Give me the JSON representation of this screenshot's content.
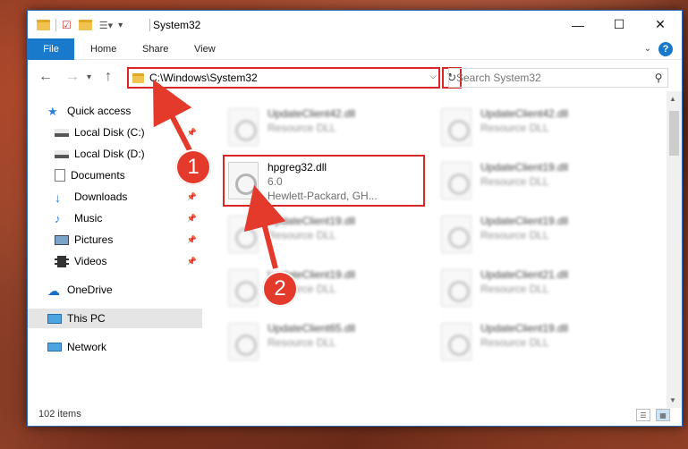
{
  "window": {
    "title": "System32",
    "controls": {
      "minimize": "—",
      "maximize": "☐",
      "close": "✕"
    }
  },
  "ribbon": {
    "tabs": [
      "File",
      "Home",
      "Share",
      "View"
    ],
    "help": "?"
  },
  "navigation": {
    "address": "C:\\Windows\\System32",
    "search_placeholder": "Search System32"
  },
  "sidebar": {
    "items": [
      {
        "label": "Quick access",
        "icon": "star-icon",
        "pinned": false
      },
      {
        "label": "Local Disk (C:)",
        "icon": "drive-icon",
        "pinned": true
      },
      {
        "label": "Local Disk (D:)",
        "icon": "drive-icon",
        "pinned": false
      },
      {
        "label": "Documents",
        "icon": "documents-icon",
        "pinned": true
      },
      {
        "label": "Downloads",
        "icon": "download-icon",
        "pinned": true
      },
      {
        "label": "Music",
        "icon": "music-icon",
        "pinned": true
      },
      {
        "label": "Pictures",
        "icon": "pictures-icon",
        "pinned": true
      },
      {
        "label": "Videos",
        "icon": "videos-icon",
        "pinned": true
      },
      {
        "label": "OneDrive",
        "icon": "cloud-icon",
        "pinned": false
      },
      {
        "label": "This PC",
        "icon": "computer-icon",
        "pinned": false,
        "selected": true
      },
      {
        "label": "Network",
        "icon": "network-icon",
        "pinned": false
      }
    ]
  },
  "files": [
    {
      "name": "UpdateClient42.dll",
      "sub": "Resource DLL"
    },
    {
      "name": "UpdateClient42.dll",
      "sub": "Resource DLL"
    },
    {
      "name": "hpgreg32.dll",
      "version": "6.0",
      "company": "Hewlett-Packard, GH..."
    },
    {
      "name": "UpdateClient19.dll",
      "sub": "Resource DLL"
    },
    {
      "name": "UpdateClient19.dll",
      "sub": "Resource DLL"
    },
    {
      "name": "UpdateClient19.dll",
      "sub": "Resource DLL"
    },
    {
      "name": "UpdateClient19.dll",
      "sub": "Resource DLL"
    },
    {
      "name": "UpdateClient21.dll",
      "sub": "Resource DLL"
    },
    {
      "name": "UpdateClient65.dll",
      "sub": "Resource DLL"
    },
    {
      "name": "UpdateClient19.dll",
      "sub": "Resource DLL"
    }
  ],
  "status": {
    "count": "102 items"
  },
  "annotations": {
    "step1": "1",
    "step2": "2",
    "color": "#e33a2c"
  }
}
